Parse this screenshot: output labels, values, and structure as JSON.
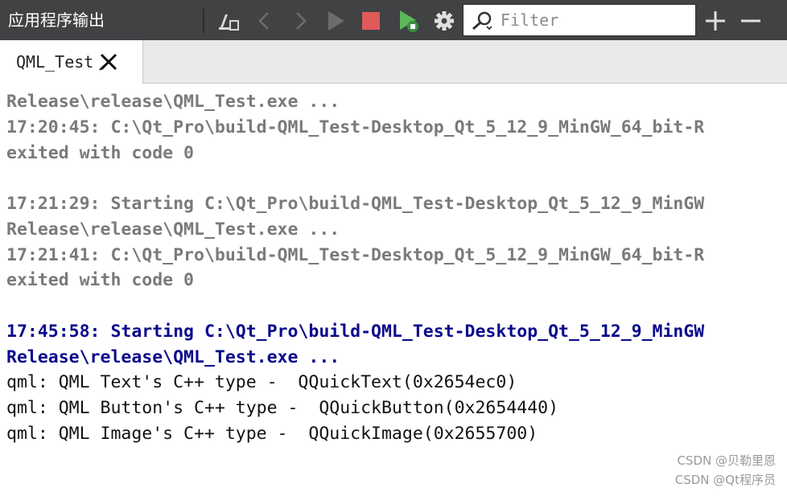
{
  "panel": {
    "title": "应用程序输出"
  },
  "toolbar": {
    "icons": [
      "attach-icon",
      "chevron-left-icon",
      "chevron-right-icon",
      "play-icon",
      "stop-icon",
      "debug-run-icon",
      "gear-icon",
      "plus-icon",
      "minus-icon"
    ],
    "filter_placeholder": "Filter",
    "filter_value": ""
  },
  "tabs": [
    {
      "label": "QML_Test",
      "active": true
    }
  ],
  "console": {
    "lines": [
      {
        "text": "Release\\release\\QML_Test.exe ...",
        "style": "past"
      },
      {
        "text": "17:20:45: C:\\Qt_Pro\\build-QML_Test-Desktop_Qt_5_12_9_MinGW_64_bit-R",
        "style": "past"
      },
      {
        "text": "exited with code 0",
        "style": "past"
      },
      {
        "text": "",
        "style": "past"
      },
      {
        "text": "17:21:29: Starting C:\\Qt_Pro\\build-QML_Test-Desktop_Qt_5_12_9_MinGW",
        "style": "past"
      },
      {
        "text": "Release\\release\\QML_Test.exe ...",
        "style": "past"
      },
      {
        "text": "17:21:41: C:\\Qt_Pro\\build-QML_Test-Desktop_Qt_5_12_9_MinGW_64_bit-R",
        "style": "past"
      },
      {
        "text": "exited with code 0",
        "style": "past"
      },
      {
        "text": "",
        "style": "past"
      },
      {
        "text": "17:45:58: Starting C:\\Qt_Pro\\build-QML_Test-Desktop_Qt_5_12_9_MinGW",
        "style": "current"
      },
      {
        "text": "Release\\release\\QML_Test.exe ...",
        "style": "current"
      },
      {
        "text": "qml: QML Text's C++ type -  QQuickText(0x2654ec0)",
        "style": "output"
      },
      {
        "text": "qml: QML Button's C++ type -  QQuickButton(0x2654440)",
        "style": "output"
      },
      {
        "text": "qml: QML Image's C++ type -  QQuickImage(0x2655700)",
        "style": "output"
      }
    ]
  },
  "watermarks": [
    "CSDN @贝勒里恩",
    "CSDN @Qt程序员"
  ],
  "colors": {
    "toolbar_bg": "#404244",
    "stop_red": "#e05a5a",
    "run_green": "#5bb85b",
    "past_text": "#7a7a7a",
    "current_text": "#0a0a8c"
  }
}
